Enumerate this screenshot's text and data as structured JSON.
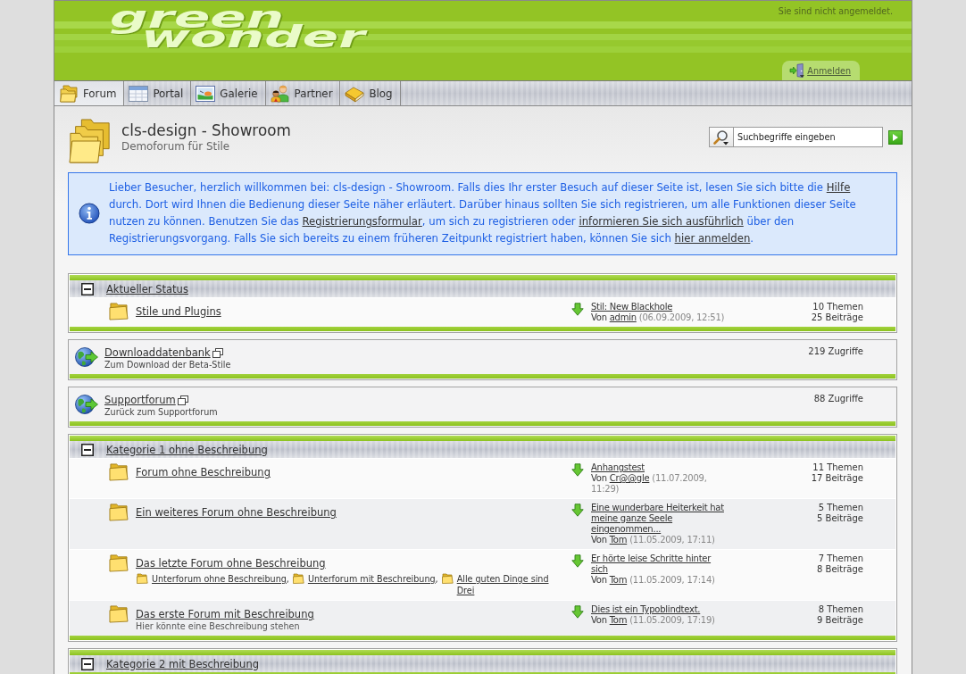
{
  "header": {
    "logo": [
      "green",
      "wonder"
    ],
    "login_status": "Sie sind nicht angemeldet.",
    "login_link": "Anmelden"
  },
  "nav_tabs": [
    {
      "label": "Forum",
      "selected": true
    },
    {
      "label": "Portal",
      "selected": false
    },
    {
      "label": "Galerie",
      "selected": false
    },
    {
      "label": "Partner",
      "selected": false
    },
    {
      "label": "Blog",
      "selected": false
    }
  ],
  "page_title": {
    "title": "cls-design - Showroom",
    "subtitle": "Demoforum für Stile"
  },
  "search": {
    "placeholder": "Suchbegriffe eingeben"
  },
  "info_message": [
    {
      "kind": "text",
      "text": "Lieber Besucher, herzlich willkommen bei: cls-design - Showroom. Falls dies Ihr erster Besuch auf dieser Seite ist, lesen Sie sich bitte die "
    },
    {
      "kind": "link",
      "text": "Hilfe"
    },
    {
      "kind": "text",
      "text": " durch. Dort wird Ihnen die Bedienung dieser Seite näher erläutert. Darüber hinaus sollten Sie sich registrieren, um alle Funktionen dieser Seite nutzen zu können. Benutzen Sie das "
    },
    {
      "kind": "link",
      "text": "Registrierungsformular"
    },
    {
      "kind": "text",
      "text": ", um sich zu registrieren oder "
    },
    {
      "kind": "link",
      "text": "informieren Sie sich ausführlich"
    },
    {
      "kind": "text",
      "text": " über den Registrierungsvorgang. Falls Sie sich bereits zu einem früheren Zeitpunkt registriert haben, können Sie sich "
    },
    {
      "kind": "link",
      "text": "hier anmelden"
    },
    {
      "kind": "text",
      "text": "."
    }
  ],
  "boards": [
    {
      "kind": "category",
      "title": "Aktueller Status",
      "expanded": true,
      "forums": [
        {
          "name": "Stile und Plugins",
          "last_post": {
            "title": "Stil: New Blackhole",
            "prefix": "Von",
            "author": "admin",
            "date": "(06.09.2009, 12:51)"
          },
          "stats": [
            "10 Themen",
            "25 Beiträge"
          ]
        }
      ]
    },
    {
      "kind": "link",
      "title": "Downloaddatenbank",
      "description": "Zum Download der Beta-Stile",
      "hits": "219 Zugriffe"
    },
    {
      "kind": "link",
      "title": "Supportforum",
      "description": "Zurück zum Supportforum",
      "hits": "88 Zugriffe"
    },
    {
      "kind": "category",
      "title": "Kategorie 1 ohne Beschreibung",
      "expanded": true,
      "forums": [
        {
          "name": "Forum ohne Beschreibung",
          "last_post": {
            "title": "Anhangstest",
            "prefix": "Von",
            "author": "Cr@@gle",
            "date": "(11.07.2009, 11:29)"
          },
          "stats": [
            "11 Themen",
            "17 Beiträge"
          ]
        },
        {
          "name": "Ein weiteres Forum ohne Beschreibung",
          "last_post": {
            "title": "Eine wunderbare Heiterkeit hat meine ganze Seele eingenommen...",
            "prefix": "Von",
            "author": "Tom",
            "date": "(11.05.2009, 17:11)"
          },
          "stats": [
            "5 Themen",
            "5 Beiträge"
          ]
        },
        {
          "name": "Das letzte Forum ohne Beschreibung",
          "subforums": [
            {
              "name": "Unterforum ohne Beschreibung",
              "separator": ","
            },
            {
              "name": "Unterforum mit Beschreibung",
              "separator": ","
            },
            {
              "name": "Alle guten Dinge sind Drei"
            }
          ],
          "last_post": {
            "title": "Er hörte leise Schritte hinter sich",
            "prefix": "Von",
            "author": "Tom",
            "date": "(11.05.2009, 17:14)"
          },
          "stats": [
            "7 Themen",
            "8 Beiträge"
          ]
        },
        {
          "name": "Das erste Forum mit Beschreibung",
          "description": "Hier könnte eine Beschreibung stehen",
          "last_post": {
            "title": "Dies ist ein Typoblindtext.",
            "prefix": "Von",
            "author": "Tom",
            "date": "(11.05.2009, 17:19)"
          },
          "stats": [
            "8 Themen",
            "9 Beiträge"
          ]
        }
      ]
    },
    {
      "kind": "category",
      "title": "Kategorie 2 mit Beschreibung",
      "expanded": true
    }
  ]
}
